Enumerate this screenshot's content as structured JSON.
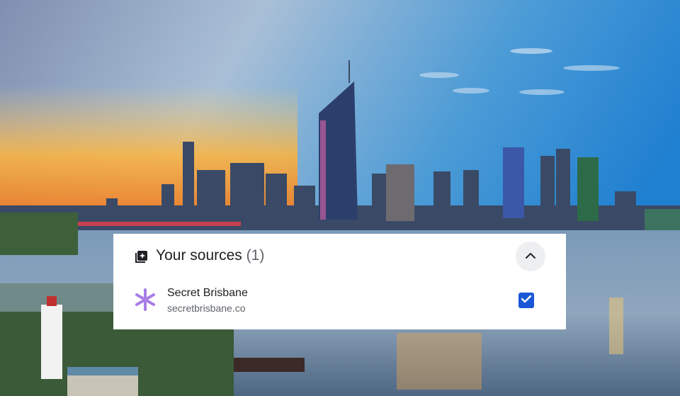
{
  "background": {
    "description_icon": "city-skyline-photo"
  },
  "sources_panel": {
    "title": "Your sources",
    "count": "(1)",
    "header_icon": "sources-icon",
    "collapse_icon": "chevron-up-icon",
    "items": [
      {
        "name": "Secret Brisbane",
        "domain": "secretbrisbane.co",
        "icon": "asterisk-icon",
        "icon_color": "#a87ee8",
        "checked": true
      }
    ],
    "checkbox_color": "#1a57d6"
  }
}
